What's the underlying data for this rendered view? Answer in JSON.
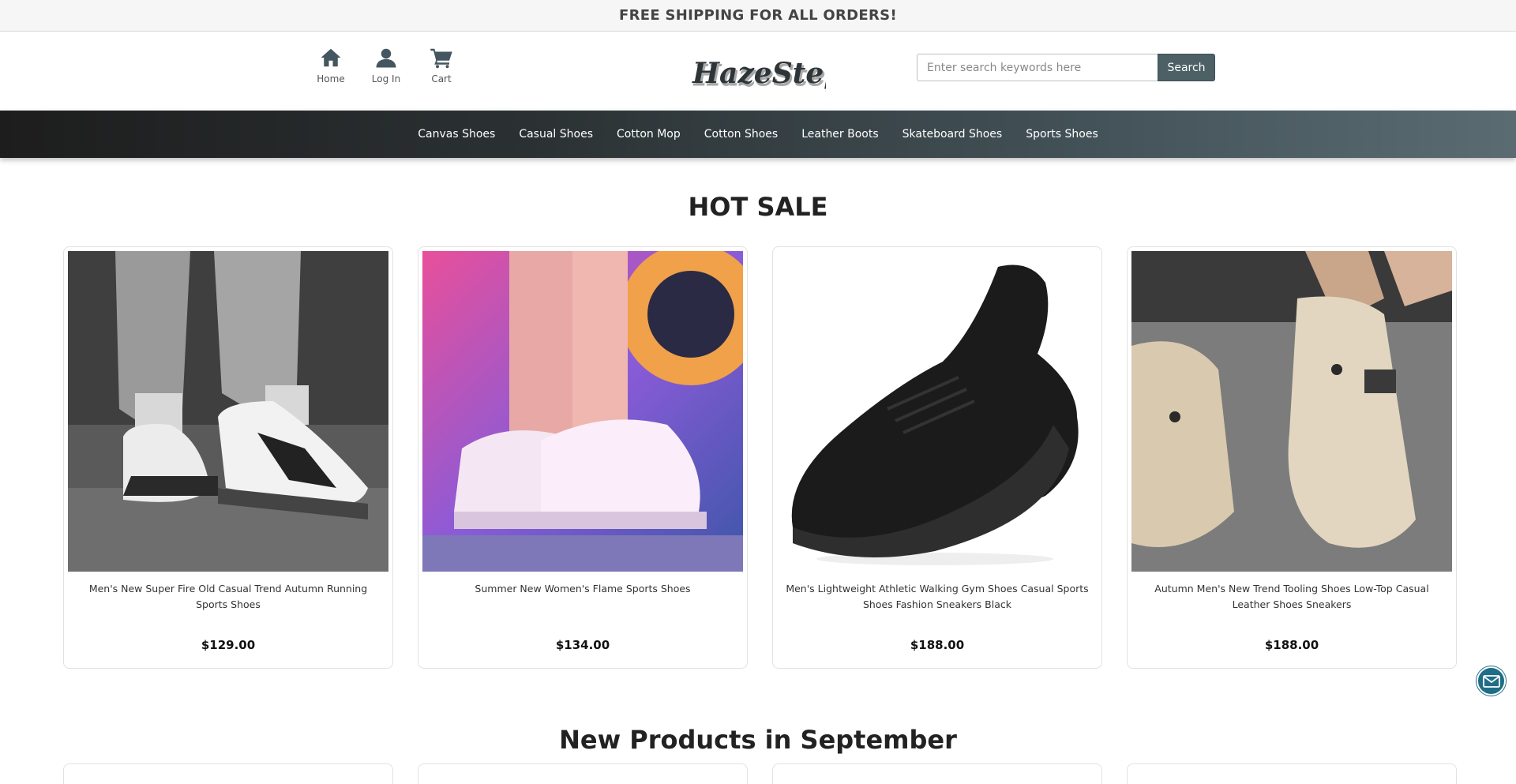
{
  "promo": {
    "text": "FREE SHIPPING FOR ALL ORDERS!"
  },
  "header": {
    "quick_links": [
      {
        "label": "Home",
        "icon": "home-icon"
      },
      {
        "label": "Log In",
        "icon": "user-icon"
      },
      {
        "label": "Cart",
        "icon": "cart-icon"
      }
    ],
    "logo_text": "HazeStep",
    "search": {
      "placeholder": "Enter search keywords here",
      "value": "",
      "button_label": "Search"
    }
  },
  "nav": {
    "items": [
      "Canvas Shoes",
      "Casual Shoes",
      "Cotton Mop",
      "Cotton Shoes",
      "Leather Boots",
      "Skateboard Shoes",
      "Sports Shoes"
    ]
  },
  "hot_sale": {
    "title": "HOT SALE",
    "products": [
      {
        "name": "Men's New Super Fire Old Casual Trend Autumn Running Sports Shoes",
        "price": "$129.00"
      },
      {
        "name": "Summer New Women's Flame Sports Shoes",
        "price": "$134.00"
      },
      {
        "name": "Men's Lightweight Athletic Walking Gym Shoes Casual Sports Shoes Fashion Sneakers Black",
        "price": "$188.00"
      },
      {
        "name": "Autumn Men's New Trend Tooling Shoes Low-Top Casual Leather Shoes Sneakers",
        "price": "$188.00"
      }
    ]
  },
  "new_products": {
    "title": "New Products in September"
  },
  "colors": {
    "accent": "#4c6066",
    "nav_start": "#1d1d1d",
    "nav_end": "#5a6c72",
    "mail_button": "#1f6d87"
  }
}
